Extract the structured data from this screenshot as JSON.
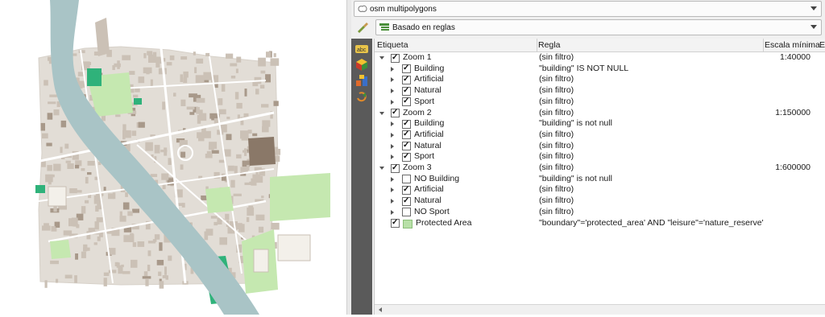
{
  "layer_combo": {
    "value": "osm multipolygons",
    "icon": "polygon-layer-icon"
  },
  "renderer_combo": {
    "value": "Basado en reglas",
    "icon": "rule-based-renderer-icon"
  },
  "toolbar": [
    {
      "icon": "labels-abc-icon"
    },
    {
      "icon": "symbology-cube-icon"
    },
    {
      "icon": "diagrams-icon"
    },
    {
      "icon": "history-icon"
    }
  ],
  "table": {
    "headers": {
      "label": "Etiqueta",
      "rule": "Regla",
      "min_scale": "Escala mínima",
      "extra": "E"
    },
    "rows": [
      {
        "label": "Zoom 1",
        "rule": "(sin filtro)",
        "scale": "1:40000",
        "level": 0,
        "expanded": true,
        "checked": true
      },
      {
        "label": "Building",
        "rule": "\"building\" IS NOT NULL",
        "scale": "",
        "level": 1,
        "expanded": false,
        "checked": true
      },
      {
        "label": "Artificial",
        "rule": "(sin filtro)",
        "scale": "",
        "level": 1,
        "expanded": false,
        "checked": true
      },
      {
        "label": "Natural",
        "rule": "(sin filtro)",
        "scale": "",
        "level": 1,
        "expanded": false,
        "checked": true
      },
      {
        "label": "Sport",
        "rule": "(sin filtro)",
        "scale": "",
        "level": 1,
        "expanded": false,
        "checked": true
      },
      {
        "label": "Zoom 2",
        "rule": "(sin filtro)",
        "scale": "1:150000",
        "level": 0,
        "expanded": true,
        "checked": true
      },
      {
        "label": "Building",
        "rule": "\"building\" is not null",
        "scale": "",
        "level": 1,
        "expanded": false,
        "checked": true
      },
      {
        "label": "Artificial",
        "rule": "(sin filtro)",
        "scale": "",
        "level": 1,
        "expanded": false,
        "checked": true
      },
      {
        "label": "Natural",
        "rule": "(sin filtro)",
        "scale": "",
        "level": 1,
        "expanded": false,
        "checked": true
      },
      {
        "label": "Sport",
        "rule": "(sin filtro)",
        "scale": "",
        "level": 1,
        "expanded": false,
        "checked": true
      },
      {
        "label": "Zoom 3",
        "rule": "(sin filtro)",
        "scale": "1:600000",
        "level": 0,
        "expanded": true,
        "checked": true
      },
      {
        "label": "NO Building",
        "rule": "\"building\" is not null",
        "scale": "",
        "level": 1,
        "expanded": false,
        "checked": false
      },
      {
        "label": "Artificial",
        "rule": "(sin filtro)",
        "scale": "",
        "level": 1,
        "expanded": false,
        "checked": true
      },
      {
        "label": "Natural",
        "rule": "(sin filtro)",
        "scale": "",
        "level": 1,
        "expanded": false,
        "checked": true
      },
      {
        "label": "NO Sport",
        "rule": "(sin filtro)",
        "scale": "",
        "level": 1,
        "expanded": false,
        "checked": false
      },
      {
        "label": "Protected Area",
        "rule": "\"boundary\"='protected_area' AND \"leisure\"='nature_reserve'",
        "scale": "",
        "level": -1,
        "expanded": null,
        "checked": true,
        "swatch": "#b8e0a8"
      }
    ]
  },
  "colors": {
    "river": "#a9c4c6",
    "green": "#c5e8b0",
    "sport": "#2fb27a",
    "building": "#c9bfb4",
    "road": "#ffffff",
    "block": "#e2ddd6"
  }
}
